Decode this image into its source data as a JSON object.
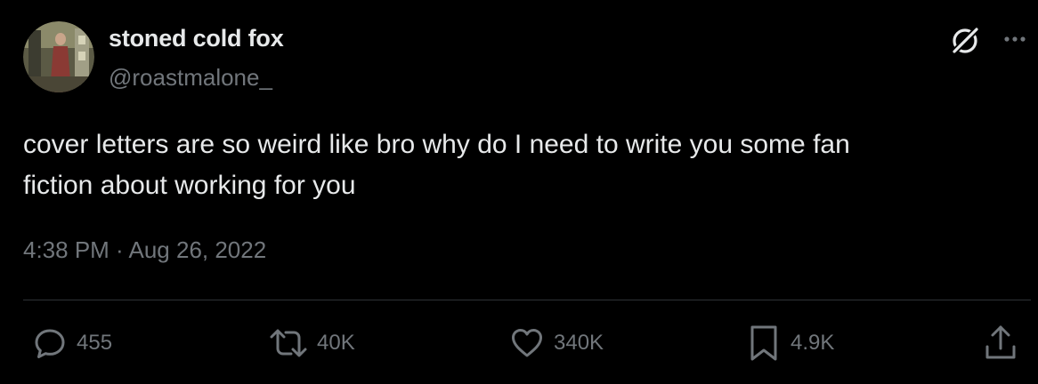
{
  "author": {
    "display_name": "stoned cold fox",
    "handle": "@roastmalone_"
  },
  "tweet": {
    "text_lines": [
      "cover letters are so weird like bro why do I need to write you some fan",
      "fiction about working for you"
    ]
  },
  "meta": {
    "timestamp": "4:38 PM · Aug 26, 2022"
  },
  "actions": {
    "reply_count": "455",
    "retweet_count": "40K",
    "like_count": "340K",
    "bookmark_count": "4.9K"
  },
  "icons": {
    "grok": "grok-icon",
    "more": "more-icon",
    "reply": "reply-icon",
    "retweet": "retweet-icon",
    "like": "heart-icon",
    "bookmark": "bookmark-icon",
    "share": "share-icon"
  },
  "colors": {
    "background": "#000000",
    "primary_text": "#e7e9ea",
    "secondary_text": "#71767b",
    "divider": "#2f3336"
  }
}
